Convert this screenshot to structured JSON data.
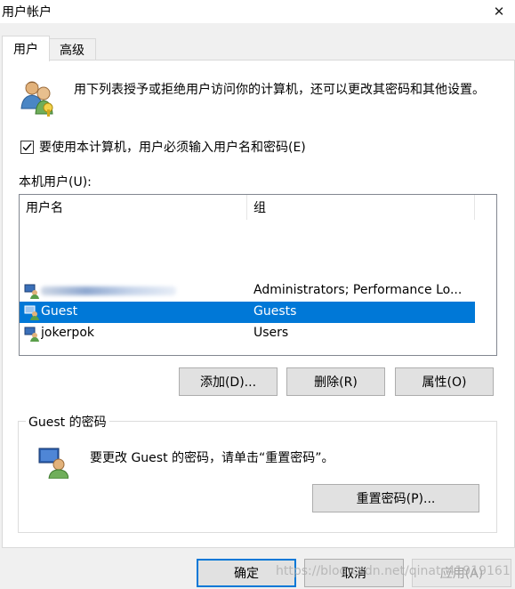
{
  "window": {
    "title": "用户帐户",
    "close_glyph": "✕"
  },
  "tabs": [
    {
      "label": "用户",
      "active": true
    },
    {
      "label": "高级",
      "active": false
    }
  ],
  "intro": {
    "text": "用下列表授予或拒绝用户访问你的计算机，还可以更改其密码和其他设置。"
  },
  "require_login": {
    "label": "要使用本计算机，用户必须输入用户名和密码(E)",
    "checked": true
  },
  "local_users": {
    "label": "本机用户(U):",
    "columns": {
      "name": "用户名",
      "group": "组"
    },
    "rows": [
      {
        "name": "",
        "group": "Administrators; Performance Lo...",
        "selected": false,
        "name_obscured": true
      },
      {
        "name": "Guest",
        "group": "Guests",
        "selected": true,
        "name_obscured": false
      },
      {
        "name": "jokerpok",
        "group": "Users",
        "selected": false,
        "name_obscured": false
      }
    ]
  },
  "actions": {
    "add": "添加(D)...",
    "remove": "删除(R)",
    "properties": "属性(O)"
  },
  "password": {
    "group_title": "Guest 的密码",
    "text": "要更改 Guest 的密码，请单击“重置密码”。",
    "reset_button": "重置密码(P)..."
  },
  "footer": {
    "ok": "确定",
    "cancel": "取消",
    "apply": "应用(A)"
  },
  "watermark": "https://blog.csdn.net/qinat_41919161",
  "colors": {
    "selection": "#0078d7",
    "panel": "#ffffff",
    "window_bg": "#f0f0f0"
  },
  "icons": {
    "users": "users-icon",
    "user_row": "user-icon",
    "password": "user-password-icon",
    "close": "close-icon"
  }
}
